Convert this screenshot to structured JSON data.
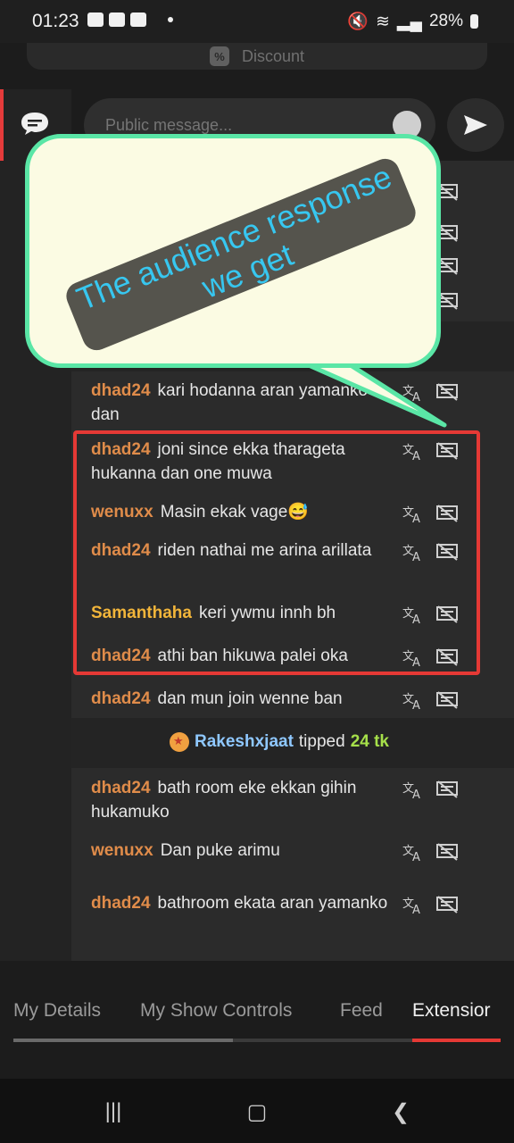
{
  "status_bar": {
    "time": "01:23",
    "battery": "28%"
  },
  "discount": {
    "icon": "percent-icon",
    "icon_glyph": "%",
    "label": "Discount"
  },
  "composer": {
    "placeholder": "Public message..."
  },
  "messages": [
    {
      "user": "dhad24",
      "text": "kari hodanna aran yamanko dan",
      "color": "#e08c4a"
    },
    {
      "user": "dhad24",
      "text": "joni since ekka tharageta hukanna dan one muwa",
      "color": "#e08c4a"
    },
    {
      "user": "wenuxx",
      "text": "Masin ekak vage😅",
      "color": "#e08c4a"
    },
    {
      "user": "dhad24",
      "text": "riden nathai me arina arillata",
      "color": "#e08c4a"
    },
    {
      "user": "Samanthaha",
      "text": "keri ywmu innh bh",
      "color": "#f2b53a"
    },
    {
      "user": "dhad24",
      "text": "athi ban hikuwa palei oka",
      "color": "#e08c4a"
    },
    {
      "user": "dhad24",
      "text": "dan mun join wenne ban",
      "color": "#e08c4a"
    },
    {
      "user": "dhad24",
      "text": "bath room eke ekkan gihin hukamuko",
      "color": "#e08c4a"
    },
    {
      "user": "wenuxx",
      "text": "Dan puke arimu",
      "color": "#e08c4a"
    },
    {
      "user": "dhad24",
      "text": "bathroom ekata aran yamanko",
      "color": "#e08c4a"
    }
  ],
  "tip": {
    "user": "Rakeshxjaat",
    "verb": "tipped",
    "amount": "24 tk"
  },
  "callout": {
    "text": "The audience response\nwe get",
    "border_color": "#5ae6a6",
    "text_color": "#37c7f0"
  },
  "tabs": [
    {
      "label": "My Details"
    },
    {
      "label": "My Show Controls"
    },
    {
      "label": "Feed"
    },
    {
      "label": "Extensior"
    }
  ],
  "colors": {
    "accent": "#e53935",
    "background": "#2b2b2b"
  }
}
